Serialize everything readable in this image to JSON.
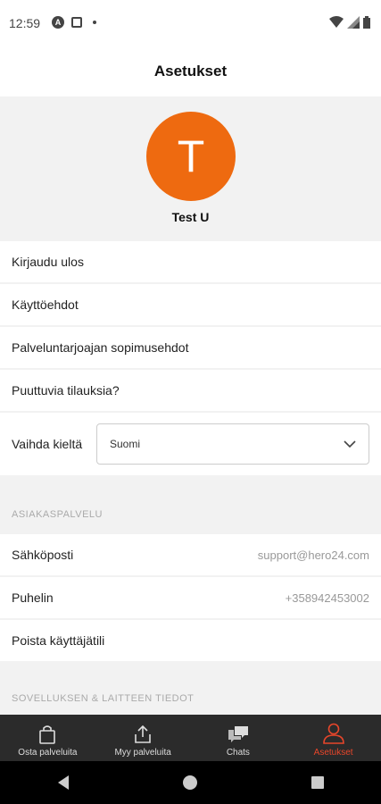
{
  "status": {
    "time": "12:59"
  },
  "header": {
    "title": "Asetukset"
  },
  "profile": {
    "initial": "T",
    "name": "Test U",
    "avatar_color": "#ee6a10"
  },
  "menu": {
    "logout": "Kirjaudu ulos",
    "terms": "Käyttöehdot",
    "provider_terms": "Palveluntarjoajan sopimusehdot",
    "missing_orders": "Puuttuvia tilauksia?",
    "language_label": "Vaihda kieltä",
    "language_value": "Suomi"
  },
  "support": {
    "section": "ASIAKASPALVELU",
    "email_label": "Sähköposti",
    "email_value": "support@hero24.com",
    "phone_label": "Puhelin",
    "phone_value": "+358942453002",
    "delete_account": "Poista käyttäjätili"
  },
  "app_info": {
    "section": "SOVELLUKSEN & LAITTEEN TIEDOT"
  },
  "nav": {
    "items": [
      {
        "label": "Osta palveluita",
        "icon": "shopping-bag-icon"
      },
      {
        "label": "Myy palveluita",
        "icon": "share-upload-icon"
      },
      {
        "label": "Chats",
        "icon": "chat-bubbles-icon"
      },
      {
        "label": "Asetukset",
        "icon": "user-icon"
      }
    ],
    "active_color": "#e8462b"
  }
}
